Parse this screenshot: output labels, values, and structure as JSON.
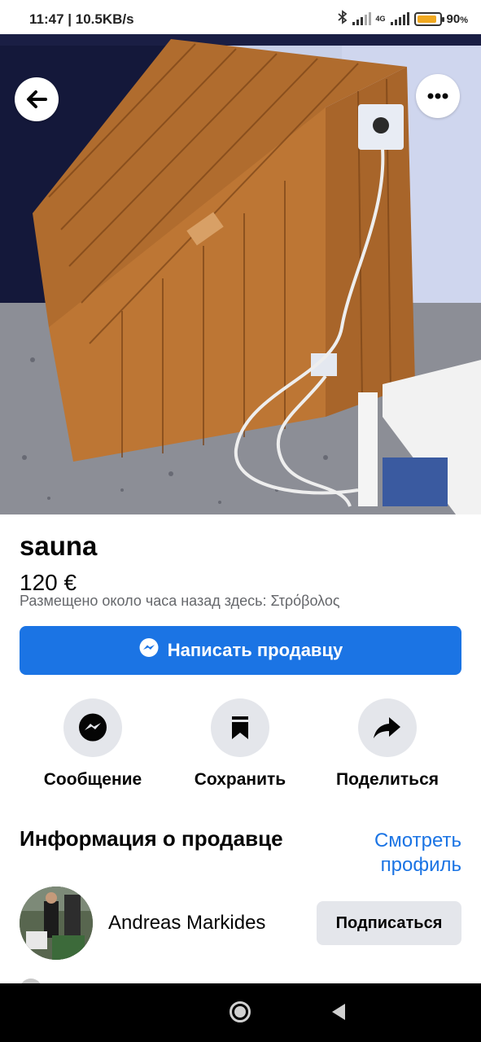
{
  "status_bar": {
    "time": "11:47 | 10.5KB/s",
    "network": "4G",
    "battery_percent_label": "90",
    "battery_unit": "%",
    "battery_level": 0.9,
    "icons": [
      "bluetooth-icon",
      "signal-icon",
      "battery-icon"
    ]
  },
  "listing": {
    "title": "sauna",
    "price": "120 €",
    "meta": "Размещено около часа назад здесь: Στρόβολος",
    "photo_description_icon": "listing-photo"
  },
  "buttons": {
    "message_seller": "Написать продавцу",
    "back_icon": "arrow-left-icon",
    "more_icon": "more-horizontal-icon"
  },
  "actions": [
    {
      "label": "Сообщение",
      "icon": "messenger-icon"
    },
    {
      "label": "Сохранить",
      "icon": "bookmark-icon"
    },
    {
      "label": "Поделиться",
      "icon": "share-arrow-icon"
    }
  ],
  "seller": {
    "heading": "Информация о продавце",
    "view_profile": "Смотреть профиль",
    "name": "Andreas Markides",
    "follow": "Подписаться"
  },
  "colors": {
    "accent": "#1b74e4",
    "secondary_button": "#e4e6eb",
    "text": "#050505",
    "muted": "#65676b"
  }
}
